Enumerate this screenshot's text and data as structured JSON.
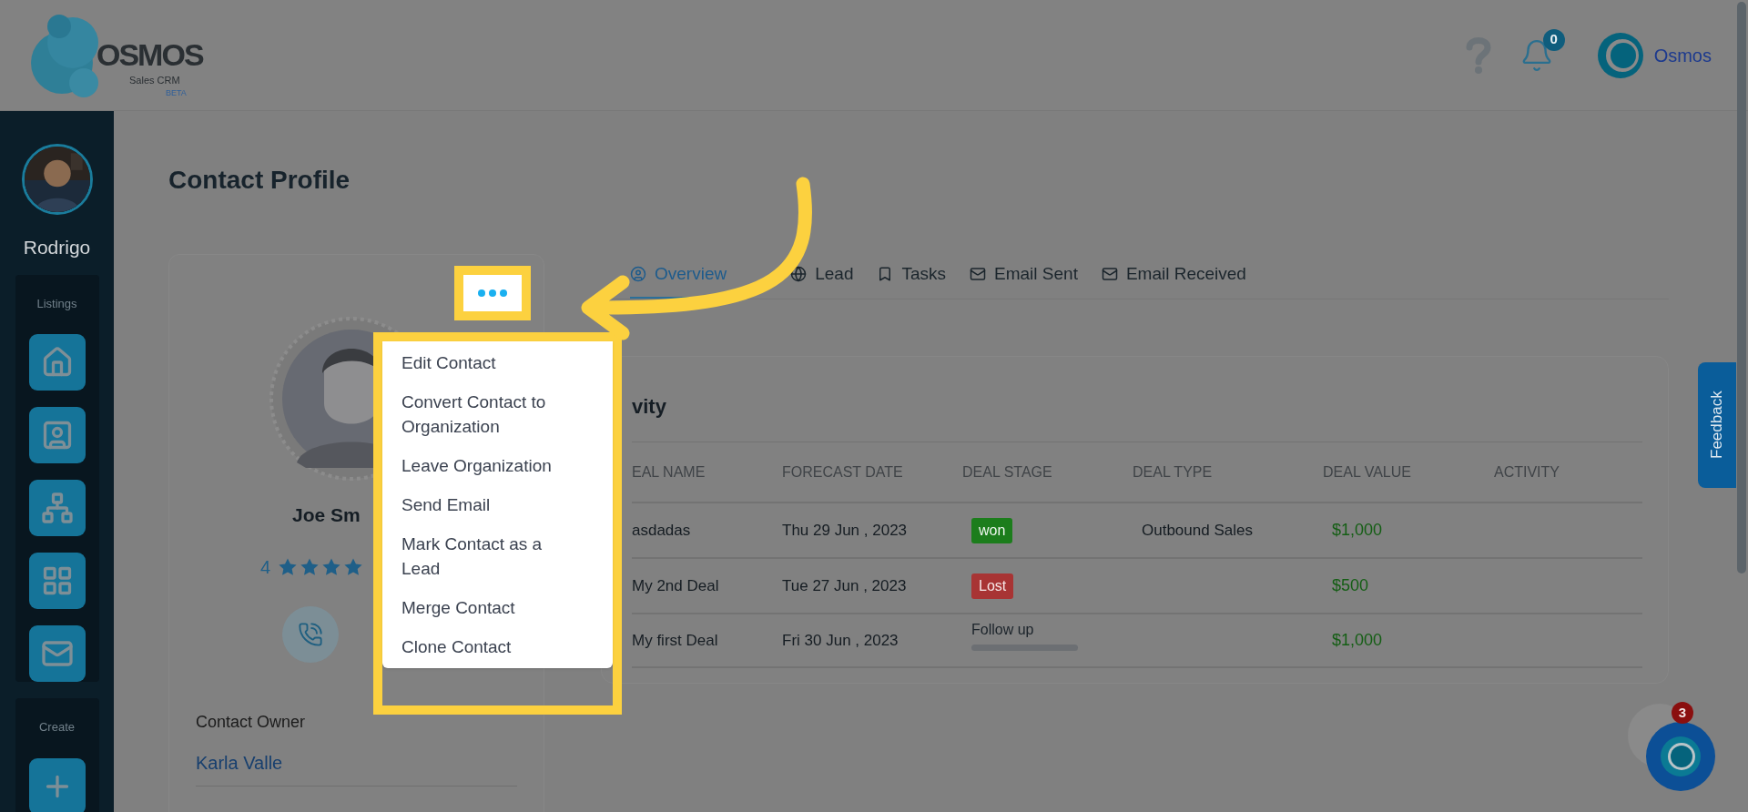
{
  "header": {
    "logo": {
      "name": "OSMOS",
      "subtitle": "Sales CRM",
      "badge": "BETA"
    },
    "notifications": "0",
    "user": "Osmos"
  },
  "sidebar": {
    "user_name": "Rodrigo",
    "sections": [
      {
        "label": "Listings",
        "items": [
          {
            "kind": "home"
          },
          {
            "kind": "contact"
          },
          {
            "kind": "hierarchy"
          },
          {
            "kind": "grid"
          },
          {
            "kind": "mail"
          }
        ]
      },
      {
        "label": "Create",
        "items": [
          {
            "kind": "add"
          }
        ]
      }
    ]
  },
  "page_title": "Contact Profile",
  "contact": {
    "name": "Joe Sm",
    "rating": "4",
    "stars": 4,
    "owner_label": "Contact Owner",
    "owner": "Karla Valle"
  },
  "menu": {
    "items": [
      "Edit Contact",
      "Convert Contact to Organization",
      "Leave Organization",
      "Send Email",
      "Mark Contact as a Lead",
      "Merge Contact",
      "Clone Contact"
    ]
  },
  "tabs": [
    {
      "label": "Overview",
      "kind": "overview",
      "selected": true
    },
    {
      "label": "Lead",
      "kind": "lead",
      "selected": false
    },
    {
      "label": "Tasks",
      "kind": "tasks",
      "selected": false
    },
    {
      "label": "Email Sent",
      "kind": "mail",
      "selected": false
    },
    {
      "label": "Email Received",
      "kind": "mail",
      "selected": false
    }
  ],
  "activity": {
    "title": "vity",
    "columns": [
      "EAL NAME",
      "FORECAST DATE",
      "DEAL STAGE",
      "DEAL TYPE",
      "DEAL VALUE",
      "ACTIVITY"
    ],
    "rows": [
      {
        "name": "asdadas",
        "date": "Thu 29 Jun , 2023",
        "stage": {
          "label": "won",
          "kind": "won"
        },
        "type": "Outbound Sales",
        "value": "$1,000"
      },
      {
        "name": "My 2nd Deal",
        "date": "Tue 27 Jun , 2023",
        "stage": {
          "label": "Lost",
          "kind": "lost"
        },
        "value": "$500"
      },
      {
        "name": "My first Deal",
        "date": "Fri 30 Jun , 2023",
        "stage": {
          "label": "Follow up",
          "kind": "progress"
        },
        "value": "$1,000"
      }
    ]
  },
  "feedback": "Feedback",
  "chat": {
    "badge": "3"
  }
}
